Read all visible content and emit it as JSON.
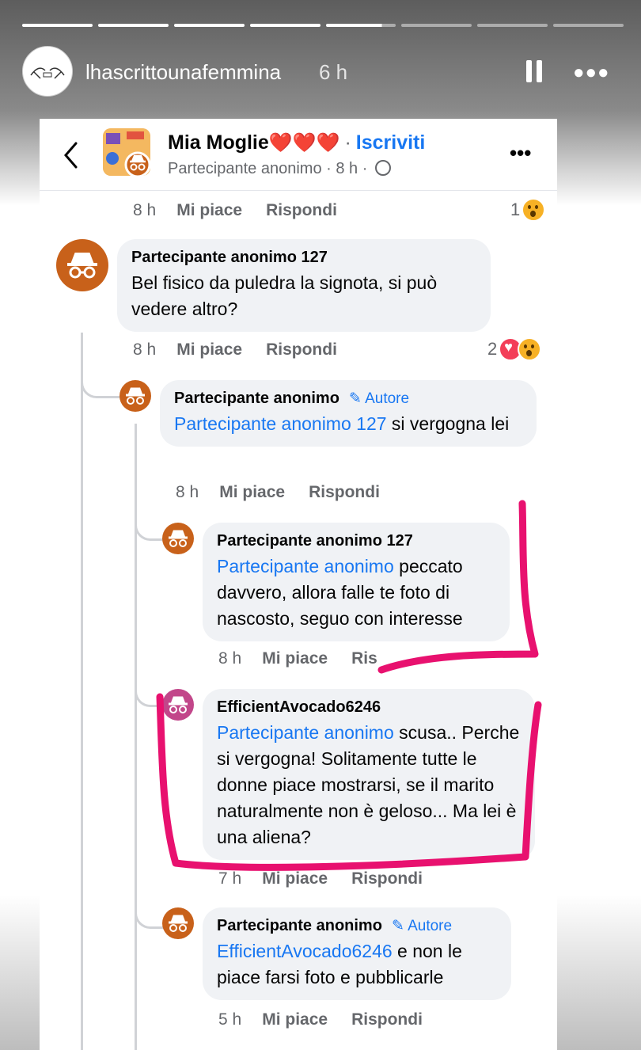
{
  "story": {
    "username": "lhascrittounafemmina",
    "time": "6 h",
    "progress_segments": 8,
    "progress_done": 4,
    "progress_partial_fraction": 0.8,
    "icons": [
      "pause-icon",
      "more-icon"
    ]
  },
  "post": {
    "group_name": "Mia Moglie",
    "hearts": "❤️❤️❤️",
    "dot": "·",
    "join_label": "Iscriviti",
    "author": "Partecipante anonimo",
    "time": "8 h",
    "privacy_icon": "globe-icon"
  },
  "actions": {
    "like": "Mi piace",
    "reply": "Rispondi"
  },
  "top_row": {
    "time": "8 h",
    "reaction_count": "1"
  },
  "comments": [
    {
      "author": "Partecipante anonimo 127",
      "text": "Bel fisico da puledra la signota, si può vedere altro?",
      "time": "8 h",
      "reaction_count": "2"
    },
    {
      "author": "Partecipante anonimo",
      "badge": "Autore",
      "mention": "Partecipante anonimo 127",
      "text": " si vergogna lei",
      "time": "8 h"
    },
    {
      "author": "Partecipante anonimo 127",
      "mention": "Partecipante anonimo",
      "text": " peccato davvero, allora falle te foto di nascosto, seguo con interesse",
      "time": "8 h",
      "reply_partial": "Ris"
    },
    {
      "author": "EfficientAvocado6246",
      "mention": "Partecipante anonimo",
      "text": " scusa.. Perche si vergogna!  Solitamente tutte le donne piace mostrarsi, se il marito naturalmente non è geloso...  Ma lei è una aliena?",
      "time": "7 h"
    },
    {
      "author": "Partecipante anonimo",
      "badge": "Autore",
      "mention": "EfficientAvocado6246",
      "text": " e non le piace farsi foto e pubblicarle",
      "time": "5 h"
    }
  ],
  "colors": {
    "link": "#1877f2",
    "avatar": "#c8611a",
    "highlighter": "#e8116f"
  }
}
